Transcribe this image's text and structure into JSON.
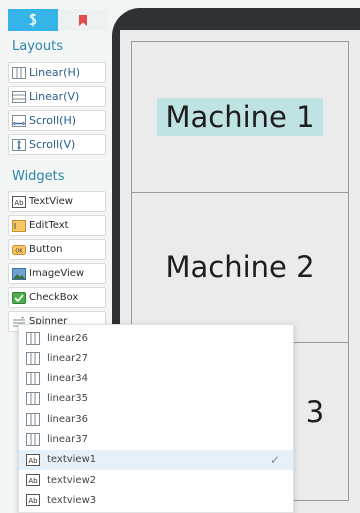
{
  "palette": {
    "tabs": [
      {
        "icon": "code-icon",
        "active": true
      },
      {
        "icon": "bookmark-icon",
        "active": false
      }
    ],
    "layouts_title": "Layouts",
    "layouts": [
      {
        "label": "Linear(H)",
        "icon": "linear-h-icon"
      },
      {
        "label": "Linear(V)",
        "icon": "linear-v-icon"
      },
      {
        "label": "Scroll(H)",
        "icon": "scroll-h-icon"
      },
      {
        "label": "Scroll(V)",
        "icon": "scroll-v-icon"
      }
    ],
    "widgets_title": "Widgets",
    "widgets": [
      {
        "label": "TextView",
        "icon": "textview-icon"
      },
      {
        "label": "EditText",
        "icon": "edittext-icon"
      },
      {
        "label": "Button",
        "icon": "button-icon"
      },
      {
        "label": "ImageView",
        "icon": "imageview-icon"
      },
      {
        "label": "CheckBox",
        "icon": "checkbox-icon"
      },
      {
        "label": "Spinner",
        "icon": "spinner-icon"
      }
    ]
  },
  "preview": {
    "cells": [
      {
        "text": "Machine 1",
        "selected": true
      },
      {
        "text": "Machine 2",
        "selected": false
      },
      {
        "text": "3",
        "selected": false
      }
    ]
  },
  "dropdown": {
    "items": [
      {
        "label": "linear26",
        "icon": "linear-icon",
        "selected": false
      },
      {
        "label": "linear27",
        "icon": "linear-icon",
        "selected": false
      },
      {
        "label": "linear34",
        "icon": "linear-icon",
        "selected": false
      },
      {
        "label": "linear35",
        "icon": "linear-icon",
        "selected": false
      },
      {
        "label": "linear36",
        "icon": "linear-icon",
        "selected": false
      },
      {
        "label": "linear37",
        "icon": "linear-icon",
        "selected": false
      },
      {
        "label": "textview1",
        "icon": "textview-icon",
        "selected": true
      },
      {
        "label": "textview2",
        "icon": "textview-icon",
        "selected": false
      },
      {
        "label": "textview3",
        "icon": "textview-icon",
        "selected": false
      }
    ],
    "check_glyph": "✓"
  },
  "colors": {
    "accent": "#34b4e8",
    "section_title": "#2b86a8",
    "selected_cell": "#bfe2e3",
    "device_frame": "#2f3235"
  }
}
